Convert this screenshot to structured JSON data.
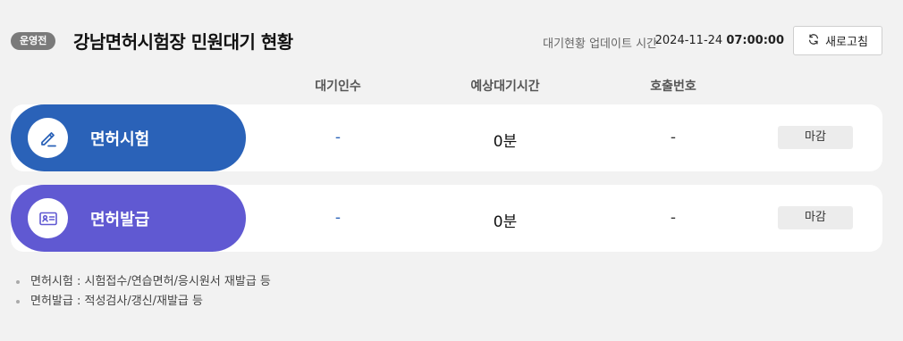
{
  "header": {
    "status_badge": "운영전",
    "title": "강남면허시험장 민원대기 현황",
    "update_label": "대기현황 업데이트 시간",
    "update_date": "2024-11-24",
    "update_clock": "07:00:00",
    "refresh_label": "새로고침"
  },
  "columns": {
    "waiting": "대기인수",
    "expected_time": "예상대기시간",
    "call_number": "호출번호"
  },
  "rows": [
    {
      "icon": "pencil-icon",
      "label": "면허시험",
      "waiting": "-",
      "expected_time": "0분",
      "call_number": "-",
      "status": "마감"
    },
    {
      "icon": "id-card-icon",
      "label": "면허발급",
      "waiting": "-",
      "expected_time": "0분",
      "call_number": "-",
      "status": "마감"
    }
  ],
  "notes": [
    "면허시험 : 시험접수/연습면허/응시원서 재발급 등",
    "면허발급 : 적성검사/갱신/재발급 등"
  ],
  "colors": {
    "exam_pill": "#2a62b8",
    "issue_pill": "#6059d2",
    "badge": "#7a7a7a"
  }
}
